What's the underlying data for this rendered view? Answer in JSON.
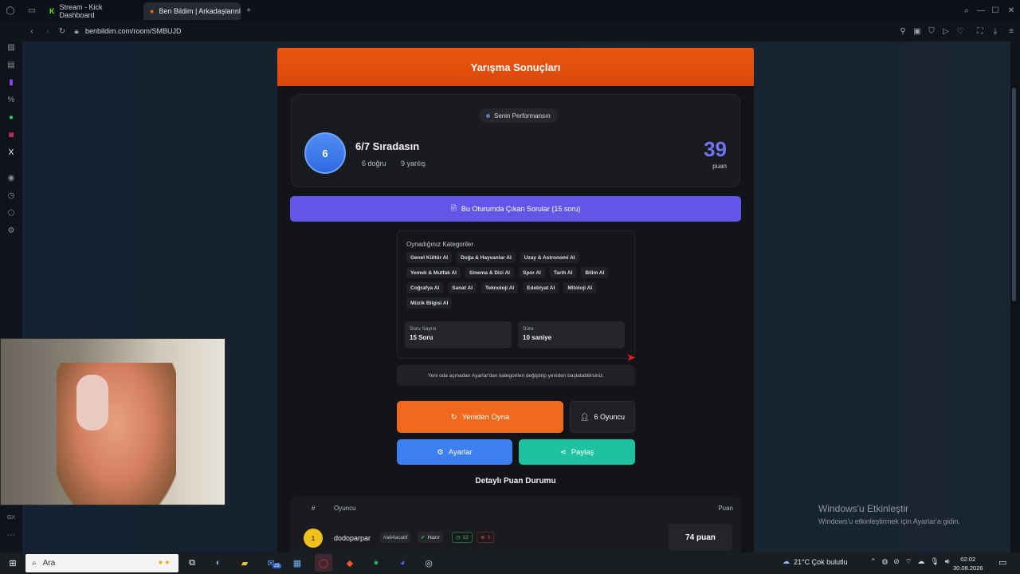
{
  "browser": {
    "tabs": [
      {
        "label": "Stream - Kick Dashboard",
        "active": false
      },
      {
        "label": "Ben Bildim | Arkadaşlarınla",
        "active": true
      }
    ],
    "url": "benbildim.com/room/SMBUJD",
    "new_tab": "+"
  },
  "results": {
    "header": "Yarışma Sonuçları",
    "performance_label": "Senin Performansın",
    "rank": "6",
    "rank_title": "6/7 Sıradasın",
    "correct": "6 doğru",
    "wrong": "9 yanlış",
    "score": "39",
    "score_unit": "puan",
    "questions_button": "Bu Oturumda Çıkan Sorular (15 soru)",
    "categories_title": "Oynadığınız Kategoriler",
    "categories": [
      "Genel Kültür AI",
      "Doğa & Hayvanlar AI",
      "Uzay & Astronomi AI",
      "Yemek & Mutfak AI",
      "Sinema & Dizi AI",
      "Spor AI",
      "Tarih AI",
      "Bilim AI",
      "Coğrafya AI",
      "Sanat AI",
      "Teknoloji AI",
      "Edebiyat AI",
      "Mitoloji AI",
      "Müzik Bilgisi AI"
    ],
    "question_count_label": "Soru Sayısı",
    "question_count_value": "15 Soru",
    "time_label": "Süre",
    "time_value": "10 saniye",
    "note": "Yeni oda açmadan Ayarlar'dan kategorileri değiştirip yeniden başlatabilirsiniz.",
    "replay_button": "Yeniden Oyna",
    "players_button": "6 Oyuncu",
    "settings_button": "Ayarlar",
    "share_button": "Paylaş",
    "detail_title": "Detaylı Puan Durumu",
    "table": {
      "col_rank": "#",
      "col_player": "Oyuncu",
      "col_score": "Puan",
      "rows": [
        {
          "rank": "1",
          "name": "dodoparpar",
          "id": "#a64acabf",
          "status": "Hazır",
          "correct": "12",
          "wrong": "3",
          "points": "74 puan"
        }
      ]
    }
  },
  "watermark": {
    "title": "Windows'u Etkinleştir",
    "subtitle": "Windows'u etkinleştirmek için Ayarlar'a gidin."
  },
  "taskbar": {
    "search_placeholder": "Ara",
    "weather": "21°C  Çok bulutlu",
    "time": "02:02",
    "date": "30.08.2026",
    "badge": "25"
  },
  "colors": {
    "accent_orange": "#ef6a1c",
    "accent_purple": "#6355e6",
    "accent_blue": "#3b7ff0",
    "accent_teal": "#1fc2a0",
    "score": "#6f74f5"
  }
}
